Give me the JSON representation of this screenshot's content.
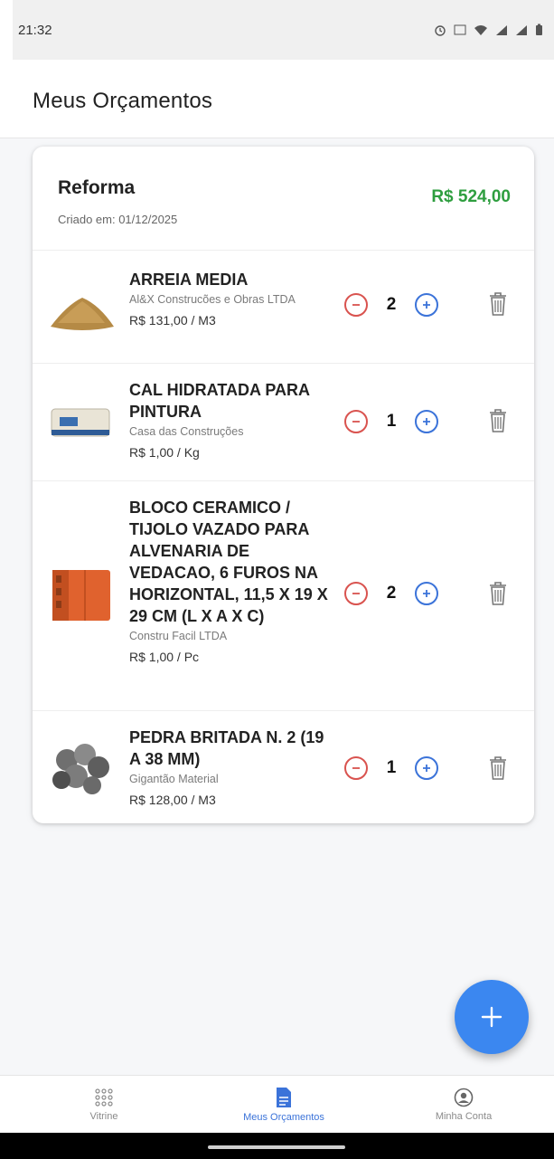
{
  "status_bar": {
    "time": "21:32"
  },
  "header": {
    "title": "Meus Orçamentos"
  },
  "budget": {
    "name": "Reforma",
    "created": "Criado em: 01/12/2025",
    "total": "R$ 524,00",
    "items": [
      {
        "name": "ARREIA MEDIA",
        "seller": "Al&X Construcões e Obras LTDA",
        "price": "R$ 131,00 / M3",
        "qty": "2"
      },
      {
        "name": "CAL HIDRATADA PARA PINTURA",
        "seller": "Casa das Construções",
        "price": "R$ 1,00 / Kg",
        "qty": "1"
      },
      {
        "name": "BLOCO CERAMICO / TIJOLO VAZADO PARA ALVENARIA DE VEDACAO, 6 FUROS NA HORIZONTAL, 11,5 X 19 X 29 CM (L X A X C)",
        "seller": "Constru Facil LTDA",
        "price": "R$ 1,00 / Pc",
        "qty": "2"
      },
      {
        "name": "PEDRA BRITADA N. 2 (19 A 38 MM)",
        "seller": "Gigantão Material",
        "price": "R$ 128,00 / M3",
        "qty": "1"
      }
    ]
  },
  "fab": {
    "icon": "plus-icon"
  },
  "bottom_nav": {
    "items": [
      {
        "label": "Vitrine",
        "icon": "grid-dots-icon"
      },
      {
        "label": "Meus Orçamentos",
        "icon": "document-icon"
      },
      {
        "label": "Minha Conta",
        "icon": "account-circle-icon"
      }
    ]
  },
  "colors": {
    "accent": "#3b73d9",
    "total": "#2e9e3f",
    "minus": "#d9534f",
    "fab": "#3b87f0"
  }
}
